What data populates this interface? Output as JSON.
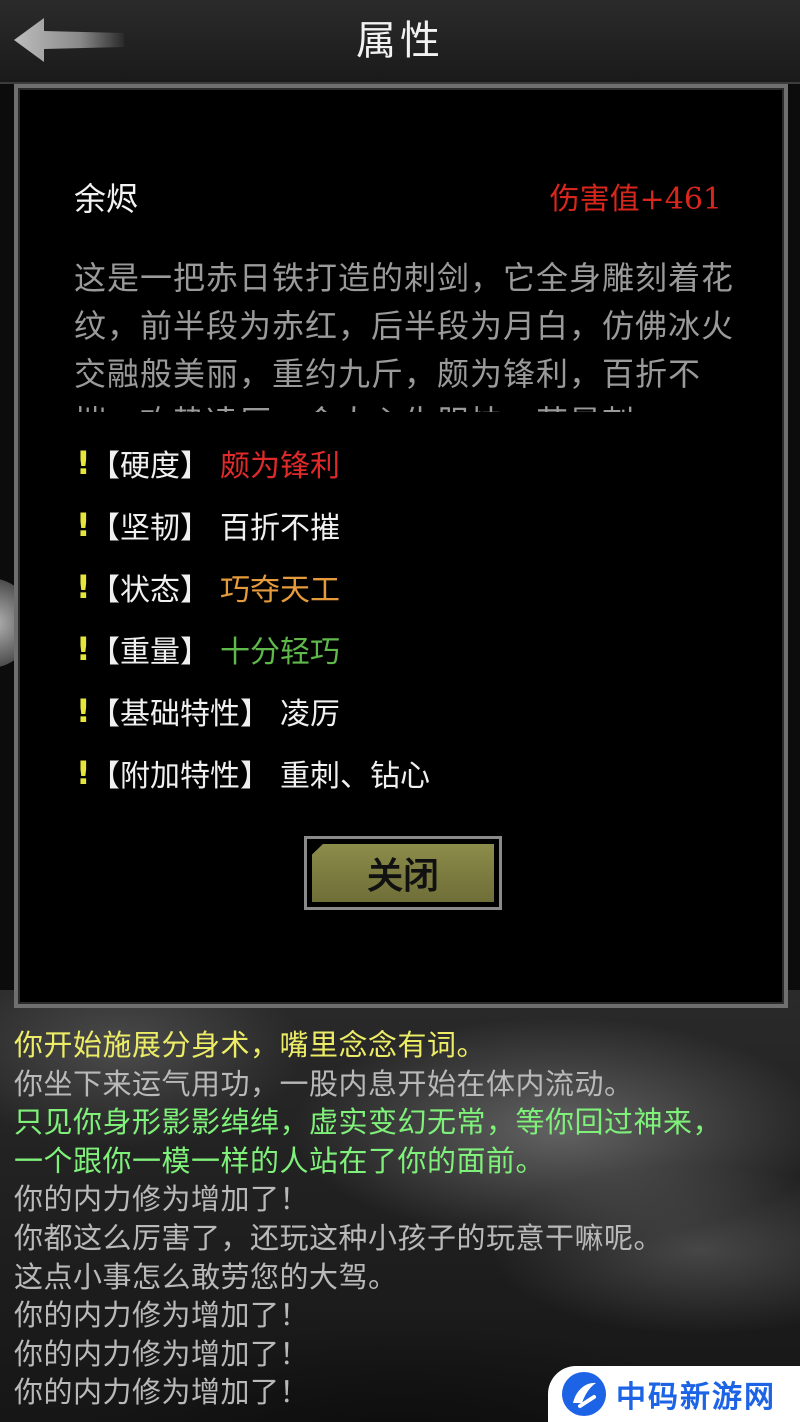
{
  "header": {
    "title": "属性"
  },
  "item": {
    "name": "余烬",
    "damage": "伤害值+461",
    "description": "这是一把赤日铁打造的刺剑，它全身雕刻着花纹，前半段为赤红，后半段为月白，仿佛冰火交融般美丽，重约九斤，颇为锋利，百折不摧，攻势凌厉，令人心生胆怯，若是刺"
  },
  "attributes": [
    {
      "label": "【硬度】",
      "value": "颇为锋利",
      "color": "#e02a2a"
    },
    {
      "label": "【坚韧】",
      "value": "百折不摧",
      "color": "#f0f0f0"
    },
    {
      "label": "【状态】",
      "value": "巧夺天工",
      "color": "#e59a3c"
    },
    {
      "label": "【重量】",
      "value": "十分轻巧",
      "color": "#5fb84a"
    },
    {
      "label": "【基础特性】",
      "value": "凌厉",
      "color": "#f0f0f0"
    },
    {
      "label": "【附加特性】",
      "value": "重刺、钻心",
      "color": "#f0f0f0"
    }
  ],
  "close_label": "关闭",
  "log": [
    {
      "text": "你开始施展分身术，嘴里念念有词。",
      "color": "yellow"
    },
    {
      "text": "你坐下来运气用功，一股内息开始在体内流动。",
      "color": "grey"
    },
    {
      "text": "只见你身形影影绰绰，虚实变幻无常，等你回过神来，",
      "color": "green"
    },
    {
      "text": "一个跟你一模一样的人站在了你的面前。",
      "color": "green"
    },
    {
      "text": "你的内力修为增加了！",
      "color": "grey"
    },
    {
      "text": "你都这么厉害了，还玩这种小孩子的玩意干嘛呢。",
      "color": "grey"
    },
    {
      "text": "这点小事怎么敢劳您的大驾。",
      "color": "grey"
    },
    {
      "text": "你的内力修为增加了！",
      "color": "grey"
    },
    {
      "text": "你的内力修为增加了！",
      "color": "grey"
    },
    {
      "text": "你的内力修为增加了！",
      "color": "grey"
    }
  ],
  "watermark": {
    "text": "中码新游网"
  },
  "icons": {
    "back": "back-arrow-icon",
    "watermark_logo": "brand-logo-icon",
    "attribute_marker": "exclamation-icon"
  }
}
